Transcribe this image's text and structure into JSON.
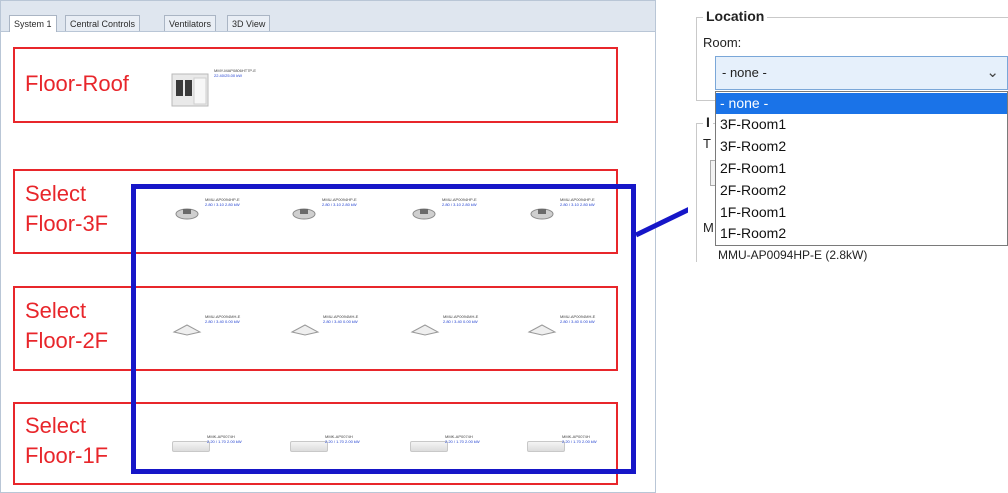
{
  "tabs": [
    {
      "label": "System 1",
      "active": true
    },
    {
      "label": "Central Controls",
      "active": false
    },
    {
      "label": "Ventilators",
      "active": false
    },
    {
      "label": "3D View",
      "active": false
    }
  ],
  "floors": [
    {
      "label": "Floor-Roof"
    },
    {
      "label": "Select\nFloor-3F"
    },
    {
      "label": "Select\nFloor-2F"
    },
    {
      "label": "Select\nFloor-1F"
    }
  ],
  "units": {
    "roof": {
      "label_line1": "MMY-MAP0806HT7P-E",
      "label_line2": "22.40/25.00 kW"
    },
    "f3": {
      "label_line1": "MMU-AP0094HP-E",
      "label_line2": "2.80 / 3.10  2.80 kW"
    },
    "f2": {
      "label_line1": "MMU-AP0094MH-E",
      "label_line2": "2.80 / 3.40  0.00 kW"
    },
    "f1": {
      "label_line1": "MMK-AP0074H",
      "label_line2": "2.20 / 1.70  2.00 kW"
    }
  },
  "properties": {
    "location_title": "Location",
    "room_label": "Room:",
    "room_value": "- none -",
    "room_options": [
      "- none -",
      "3F-Room1",
      "3F-Room2",
      "2F-Room1",
      "2F-Room2",
      "1F-Room1",
      "1F-Room2"
    ],
    "selected_index": 0,
    "hidden_group_title_fragment": "I",
    "hidden_label_1": "T",
    "hidden_label_2": "M",
    "hidden_field_text": "MMU-AP0094HP-E (2.8kW)"
  },
  "colors": {
    "floor_outline": "#e8262b",
    "highlight_box": "#1616c8",
    "dropdown_selection": "#1a73e8"
  }
}
